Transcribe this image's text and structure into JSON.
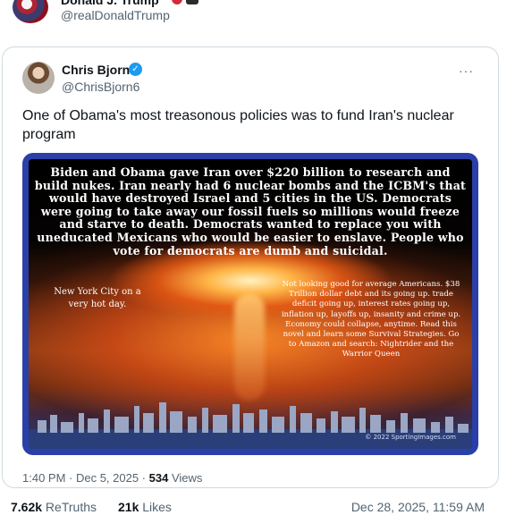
{
  "outer_post": {
    "name": "Donald J. Trump",
    "handle": "@realDonaldTrump"
  },
  "quoted_post": {
    "name": "Chris Bjorn",
    "handle": "@ChrisBjorn6",
    "more": "···",
    "verified_glyph": "✓",
    "text": "One of Obama's most treasonous policies was to fund Iran's nuclear program",
    "image": {
      "top_text": "Biden and Obama gave Iran over $220 billion to research and build nukes. Iran nearly had 6 nuclear bombs and the ICBM's that would have destroyed Israel and 5 cities in the US. Democrats were going to take away our fossil fuels so millions would freeze and starve to death. Democrats wanted to replace you with uneducated Mexicans who would be easier to enslave. People who vote for democrats are dumb and suicidal.",
      "left_text": "New York City on a very hot day.",
      "right_text": "Not looking good for average Americans. $38 Trillion dollar debt and its going up. trade deficit going up, interest rates going up, inflation up, layoffs up, insanity and crime up. Economy could collapse, anytime. Read this novel and learn some Survival Strategies. Go to Amazon and search: Nightrider and the Warrior Queen",
      "credit": "© 2022 SportingImages.com"
    },
    "time": "1:40 PM · Dec 5, 2025 · ",
    "views_count": "534",
    "views_label": " Views"
  },
  "stats": {
    "retruths_count": "7.62k",
    "retruths_label": " ReTruths",
    "likes_count": "21k",
    "likes_label": " Likes",
    "date": "Dec 28, 2025, 11:59 AM"
  },
  "colors": {
    "verified": "#1d9bf0",
    "muted_text": "#536471",
    "image_frame": "#2a3fa8"
  },
  "icons": [
    "verified-badge-icon",
    "more-options-icon"
  ]
}
